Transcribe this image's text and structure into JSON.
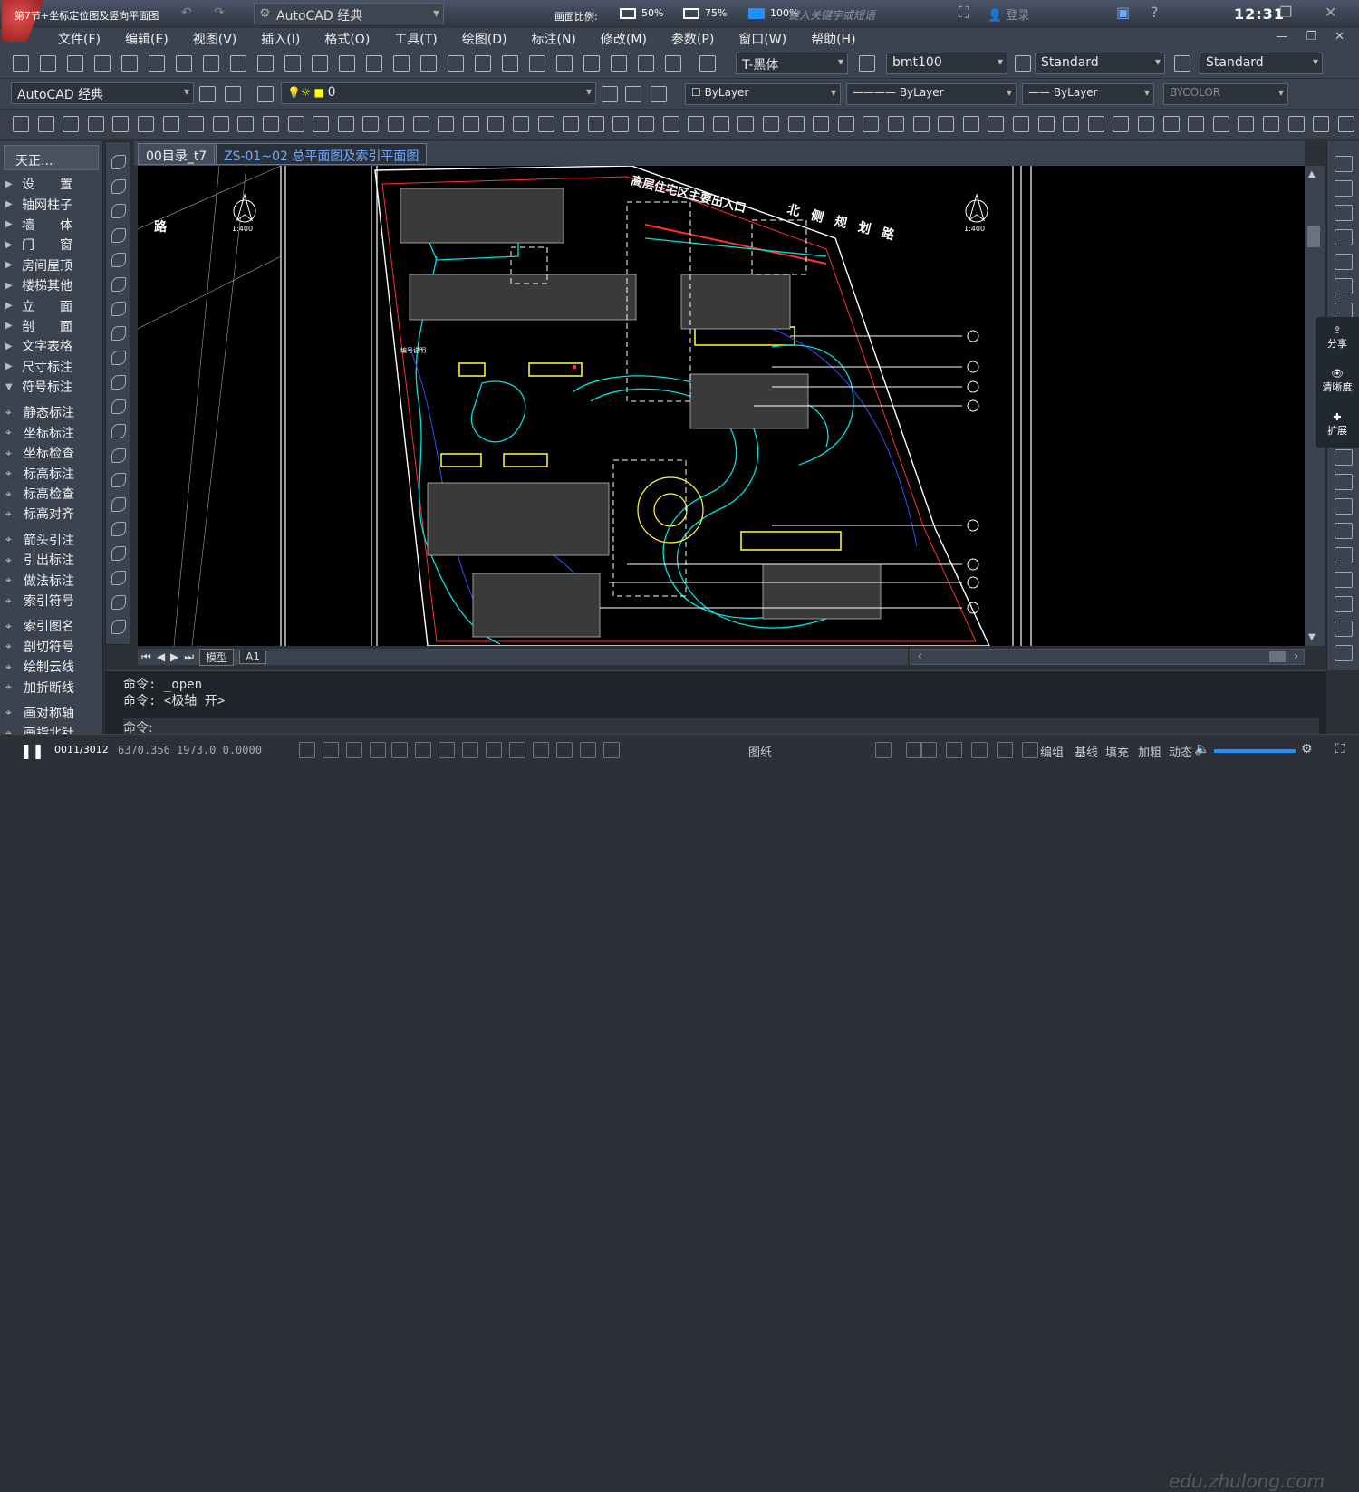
{
  "titlebar": {
    "doc_title": "第7节+坐标定位图及竖向平面图",
    "workspace": "AutoCAD 经典",
    "scale_label": "画面比例:",
    "scale_options": [
      "50%",
      "75%",
      "100%"
    ],
    "scale_selected": "100%",
    "search_placeholder": "键入关键字或短语",
    "login": "登录",
    "clock": "12:31"
  },
  "menu": [
    "文件(F)",
    "编辑(E)",
    "视图(V)",
    "插入(I)",
    "格式(O)",
    "工具(T)",
    "绘图(D)",
    "标注(N)",
    "修改(M)",
    "参数(P)",
    "窗口(W)",
    "帮助(H)"
  ],
  "toolbar": {
    "text_style": "T-黑体",
    "dim_style": "bmt100",
    "table_style": "Standard",
    "mleader_style": "Standard",
    "workspace2": "AutoCAD 经典",
    "layer": "0",
    "color": "ByLayer",
    "linetype": "ByLayer",
    "lineweight": "ByLayer",
    "plotstyle": "BYCOLOR"
  },
  "leftpanel": {
    "title": "天正...",
    "items": [
      {
        "label": "设　　置",
        "type": "folder"
      },
      {
        "label": "轴网柱子",
        "type": "folder"
      },
      {
        "label": "墙　　体",
        "type": "folder"
      },
      {
        "label": "门　　窗",
        "type": "folder"
      },
      {
        "label": "房间屋顶",
        "type": "folder"
      },
      {
        "label": "楼梯其他",
        "type": "folder"
      },
      {
        "label": "立　　面",
        "type": "folder"
      },
      {
        "label": "剖　　面",
        "type": "folder"
      },
      {
        "label": "文字表格",
        "type": "folder"
      },
      {
        "label": "尺寸标注",
        "type": "folder"
      },
      {
        "label": "符号标注",
        "type": "open"
      },
      {
        "label": "静态标注",
        "type": "tool"
      },
      {
        "label": "坐标标注",
        "type": "tool"
      },
      {
        "label": "坐标检查",
        "type": "tool"
      },
      {
        "label": "标高标注",
        "type": "tool"
      },
      {
        "label": "标高检查",
        "type": "tool"
      },
      {
        "label": "标高对齐",
        "type": "tool"
      },
      {
        "label": "箭头引注",
        "type": "tool"
      },
      {
        "label": "引出标注",
        "type": "tool"
      },
      {
        "label": "做法标注",
        "type": "tool"
      },
      {
        "label": "索引符号",
        "type": "tool"
      },
      {
        "label": "索引图名",
        "type": "tool"
      },
      {
        "label": "剖切符号",
        "type": "tool"
      },
      {
        "label": "绘制云线",
        "type": "tool"
      },
      {
        "label": "加折断线",
        "type": "tool"
      },
      {
        "label": "画对称轴",
        "type": "tool"
      },
      {
        "label": "画指北针",
        "type": "tool"
      }
    ]
  },
  "file_tabs": [
    "00目录_t7",
    "ZS-01~02 总平面图及索引平面图"
  ],
  "drawing": {
    "entrance_label": "高层住宅区主要出入口",
    "road_label": "北 侧 规 划 路",
    "north_label": "1:400",
    "left_label": "路",
    "annotation": "编号说明"
  },
  "layout_tabs": [
    "模型",
    "A1"
  ],
  "sidepop": [
    "分享",
    "清晰度",
    "扩展"
  ],
  "command": {
    "line1": "命令: _open",
    "line2": "命令: <极轴 开>",
    "prompt": "命令:"
  },
  "status": {
    "coords": "6370.356  1973.0  0.0000",
    "play_position": "0011/3012",
    "items": [
      "图纸",
      "编组",
      "基线",
      "填充",
      "加粗",
      "动态"
    ],
    "watermark": "edu.zhulong.com"
  },
  "colors": {
    "canvas": "#000000",
    "accent": "#1e90ff"
  }
}
